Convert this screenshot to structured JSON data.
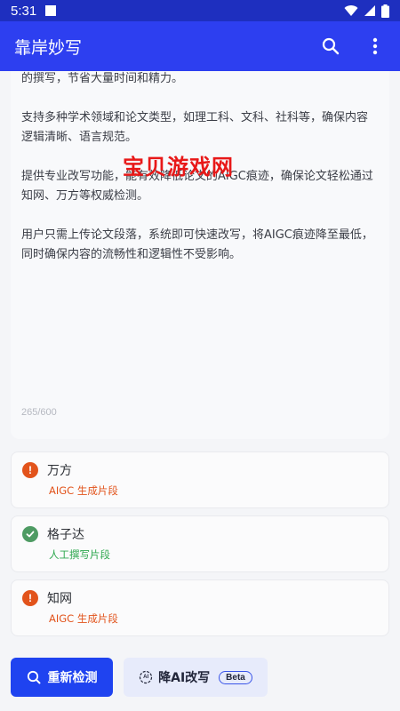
{
  "status_bar": {
    "time": "5:31"
  },
  "app_bar": {
    "title": "靠岸妙写"
  },
  "text_area": {
    "paragraphs": [
      "的撰写，节省大量时间和精力。",
      "支持多种学术领域和论文类型，如理工科、文科、社科等，确保内容逻辑清晰、语言规范。",
      "提供专业改写功能，能有效降低论文的AIGC痕迹，确保论文轻松通过知网、万方等权威检测。",
      "用户只需上传论文段落，系统即可快速改写，将AIGC痕迹降至最低，同时确保内容的流畅性和逻辑性不受影响。"
    ],
    "char_count": "265/600"
  },
  "watermark": "宝贝游戏网",
  "results": [
    {
      "name": "万方",
      "status": "AIGC 生成片段",
      "state": "warn"
    },
    {
      "name": "格子达",
      "status": "人工撰写片段",
      "state": "ok"
    },
    {
      "name": "知网",
      "status": "AIGC 生成片段",
      "state": "warn"
    }
  ],
  "actions": {
    "recheck_label": "重新检测",
    "reduce_ai_label": "降AI改写",
    "beta_label": "Beta",
    "ai_icon_text": "AI"
  },
  "icons": {
    "search": "search-icon",
    "more": "more-vert-icon",
    "warn": "warning-icon",
    "ok": "check-circle-icon"
  },
  "colors": {
    "primary": "#2d3ff0",
    "warn": "#e2531b",
    "ok": "#2fa84f"
  }
}
